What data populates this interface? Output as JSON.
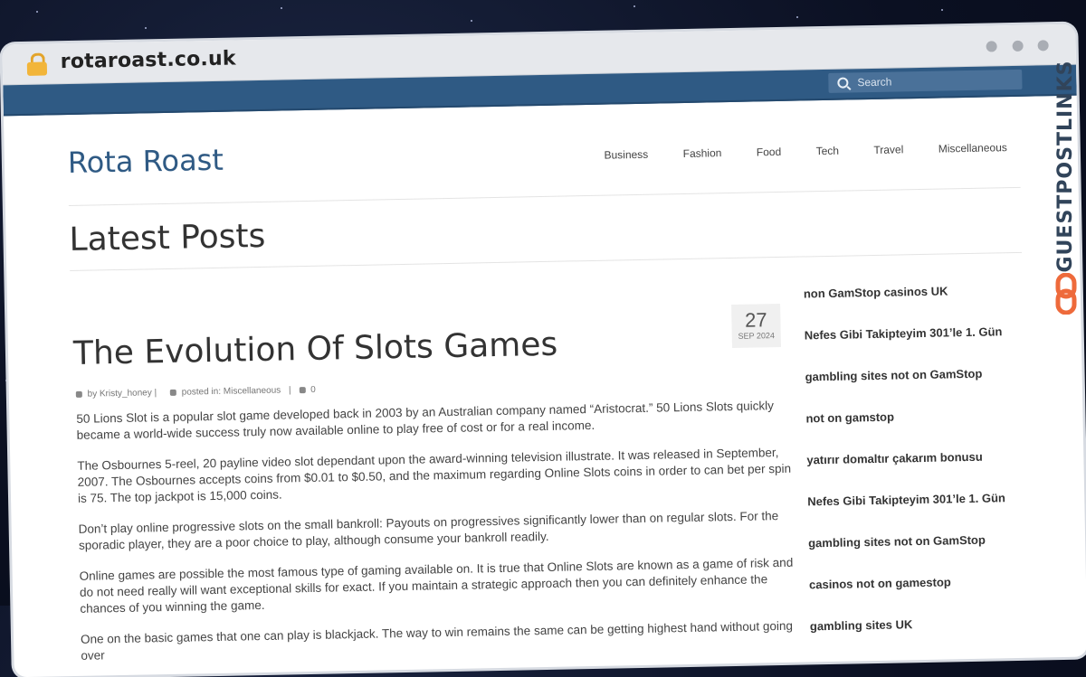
{
  "browser": {
    "url": "rotaroast.co.uk"
  },
  "topbar": {
    "search_placeholder": "Search"
  },
  "site": {
    "logo": "Rota Roast"
  },
  "nav": [
    {
      "label": "Business"
    },
    {
      "label": "Fashion"
    },
    {
      "label": "Food"
    },
    {
      "label": "Tech"
    },
    {
      "label": "Travel"
    },
    {
      "label": "Miscellaneous"
    }
  ],
  "page": {
    "title": "Latest Posts"
  },
  "post": {
    "title": "The Evolution Of Slots Games",
    "date_day": "27",
    "date_month": "SEP 2024",
    "author": "by Kristy_honey |",
    "category_prefix": "posted in:",
    "category": "Miscellaneous",
    "comments": "0",
    "paragraphs": [
      "50 Lions Slot is a popular slot game developed back in 2003 by an Australian company named “Aristocrat.” 50 Lions Slots quickly became a world-wide success truly now available online to play free of cost or for a real income.",
      "The Osbournes 5-reel, 20 payline video slot dependant upon the award-winning television illustrate. It was released in September, 2007. The Osbournes accepts coins from $0.01 to $0.50, and the maximum regarding Online Slots coins in order to can bet per spin is 75. The top jackpot is 15,000 coins.",
      "Don’t play online progressive slots on the small bankroll: Payouts on progressives significantly lower than on regular slots. For the sporadic player, they are a poor choice to play, although consume your bankroll readily.",
      "Online games are possible the most famous type of gaming available on. It is true that Online Slots are known as a game of risk and do not need really will want exceptional skills for exact. If you maintain a strategic approach then you can definitely enhance the chances of you winning the game.",
      "One on the basic games that one can play is blackjack. The way to win remains the same can be getting highest hand without going over"
    ]
  },
  "sidebar": {
    "links": [
      "non GamStop casinos UK",
      "Nefes Gibi Takipteyim 301’le 1. Gün",
      "gambling sites not on GamStop",
      "not on gamstop",
      "yatırır domaltır çakarım bonusu",
      "Nefes Gibi Takipteyim 301’le 1. Gün",
      "gambling sites not on GamStop",
      "casinos not on gamestop",
      "gambling sites UK"
    ]
  },
  "badge": {
    "text": "GUESTPOSTLINKS",
    "color": "#ee6a3b"
  },
  "colors": {
    "brand": "#2f5a84",
    "topbar": "#2f5a84"
  },
  "icons": [
    "lock-icon",
    "search-icon",
    "user-icon",
    "folder-icon",
    "comment-icon",
    "chain-link-icon"
  ]
}
